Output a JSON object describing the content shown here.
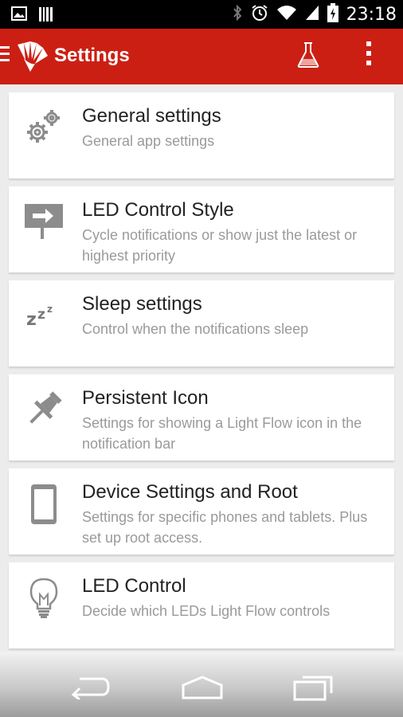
{
  "status_bar": {
    "time": "23:18",
    "left_icons": [
      "image-icon",
      "barcode-icon"
    ],
    "right_icons": [
      "bluetooth-icon",
      "alarm-icon",
      "wifi-icon",
      "signal-icon",
      "battery-charging-icon"
    ]
  },
  "action_bar": {
    "title": "Settings",
    "menu_icon": "hamburger-icon",
    "app_icon": "lightflow-logo-icon",
    "action_icon": "flask-icon",
    "overflow_icon": "overflow-menu-icon",
    "color": "#cc1f14"
  },
  "settings": [
    {
      "icon": "gear-icon",
      "title": "General settings",
      "subtitle": "General app settings"
    },
    {
      "icon": "sign-arrow-icon",
      "title": "LED Control Style",
      "subtitle": "Cycle notifications or show just the latest or highest priority"
    },
    {
      "icon": "sleep-zzz-icon",
      "title": "Sleep settings",
      "subtitle": "Control when the notifications sleep"
    },
    {
      "icon": "pushpin-icon",
      "title": "Persistent Icon",
      "subtitle": "Settings for showing a Light Flow icon in the notification bar"
    },
    {
      "icon": "phone-icon",
      "title": "Device Settings and Root",
      "subtitle": "Settings for specific phones and tablets. Plus set up root access."
    },
    {
      "icon": "lightbulb-icon",
      "title": "LED Control",
      "subtitle": "Decide which LEDs Light Flow controls"
    }
  ],
  "nav_bar": {
    "buttons": [
      "back-icon",
      "home-icon",
      "recents-icon"
    ]
  }
}
